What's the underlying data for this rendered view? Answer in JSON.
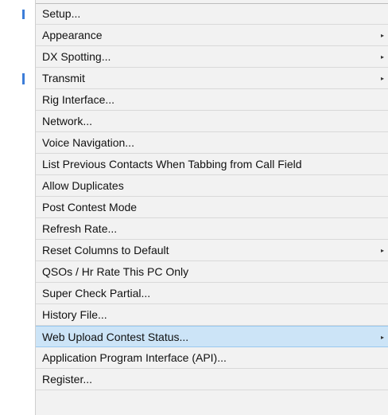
{
  "menu": {
    "items": [
      {
        "label": "Setup...",
        "has_submenu": false
      },
      {
        "label": "Appearance",
        "has_submenu": true
      },
      {
        "label": "DX Spotting...",
        "has_submenu": true
      },
      {
        "label": "Transmit",
        "has_submenu": true
      },
      {
        "label": "Rig Interface...",
        "has_submenu": false
      },
      {
        "label": "Network...",
        "has_submenu": false
      },
      {
        "label": "Voice Navigation...",
        "has_submenu": false
      },
      {
        "label": "List Previous Contacts When Tabbing from Call Field",
        "has_submenu": false
      },
      {
        "label": "Allow Duplicates",
        "has_submenu": false
      },
      {
        "label": "Post Contest Mode",
        "has_submenu": false
      },
      {
        "label": "Refresh Rate...",
        "has_submenu": false
      },
      {
        "label": "Reset Columns to Default",
        "has_submenu": true
      },
      {
        "label": "QSOs / Hr Rate This PC Only",
        "has_submenu": false
      },
      {
        "label": "Super Check Partial...",
        "has_submenu": false
      },
      {
        "label": "History File...",
        "has_submenu": false
      },
      {
        "label": "Web Upload Contest Status...",
        "has_submenu": true,
        "highlighted": true
      },
      {
        "label": "Application Program Interface (API)...",
        "has_submenu": false
      },
      {
        "label": "Register...",
        "has_submenu": false
      }
    ],
    "submenu_arrow_icon": "submenu-arrow-icon",
    "colors": {
      "background": "#f2f2f2",
      "highlight": "#cce4f7",
      "highlight_border": "#99c9ef",
      "gutter_accent": "#3c7dd8"
    }
  }
}
